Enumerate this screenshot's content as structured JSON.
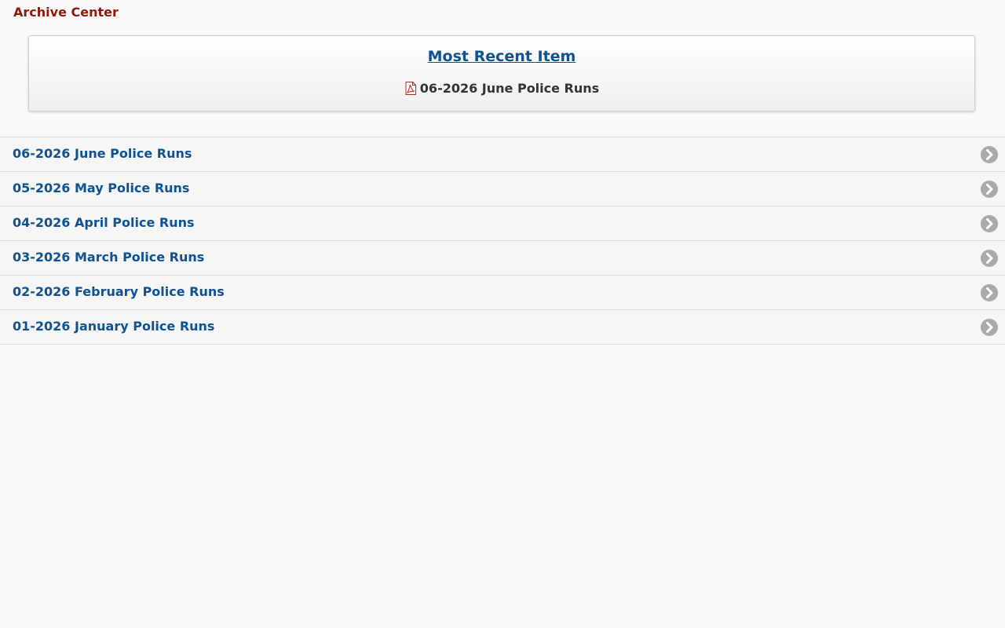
{
  "header": {
    "title": "Archive Center"
  },
  "recent": {
    "heading": "Most Recent Item",
    "item_label": "06-2026 June Police Runs",
    "item_icon": "pdf-icon"
  },
  "archive": {
    "row_icon": "chevron-right-circle-icon",
    "items": [
      {
        "label": "06-2026 June Police Runs"
      },
      {
        "label": "05-2026 May Police Runs"
      },
      {
        "label": "04-2026 April Police Runs"
      },
      {
        "label": "03-2026 March Police Runs"
      },
      {
        "label": "02-2026 February Police Runs"
      },
      {
        "label": "01-2026 January Police Runs"
      }
    ]
  },
  "colors": {
    "title": "#8a1a10",
    "link": "#0e5293",
    "background": "#f9f9f9",
    "chevron": "#aaaaaa"
  }
}
